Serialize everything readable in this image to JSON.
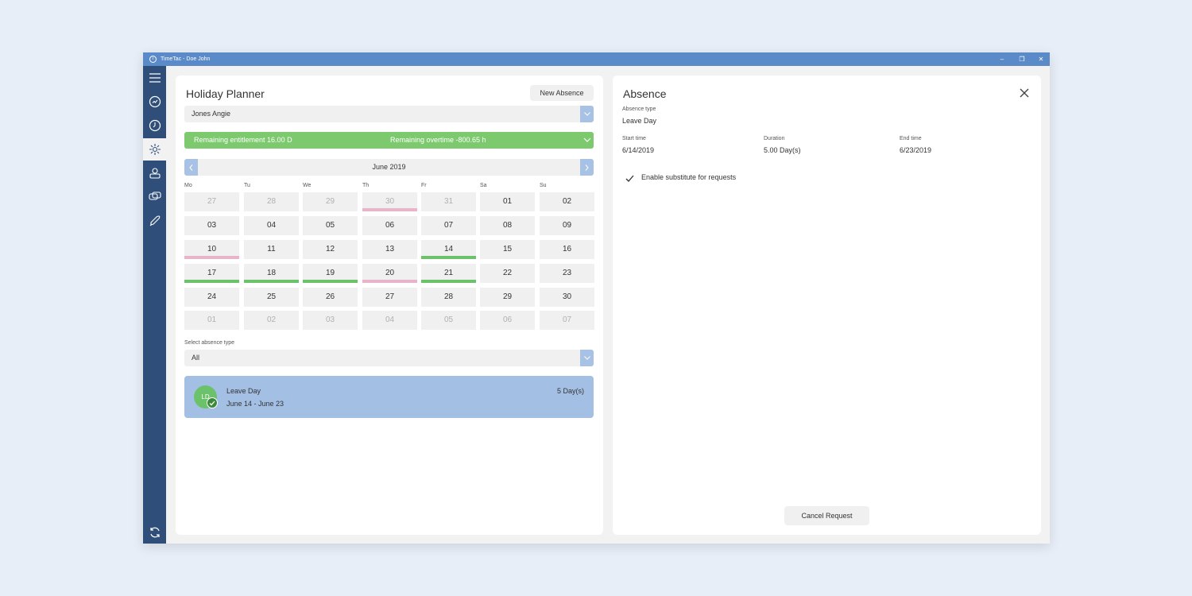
{
  "window": {
    "title": "TimeTac - Doe John",
    "controls": {
      "minimize": "–",
      "restore": "❐",
      "close": "✕"
    }
  },
  "sidebar": {
    "items": [
      {
        "name": "menu-icon"
      },
      {
        "name": "dashboard-icon"
      },
      {
        "name": "clock-icon"
      },
      {
        "name": "holiday-icon",
        "active": true
      },
      {
        "name": "team-icon"
      },
      {
        "name": "chat-icon"
      },
      {
        "name": "rocket-icon"
      }
    ],
    "bottom": {
      "name": "sync-icon"
    }
  },
  "planner": {
    "title": "Holiday Planner",
    "new_absence_label": "New Absence",
    "user_select_value": "Jones Angie",
    "entitlement": "Remaining entitlement 16.00 D",
    "overtime": "Remaining overtime -800.65 h",
    "month_label": "June 2019",
    "weekdays": [
      "Mo",
      "Tu",
      "We",
      "Th",
      "Fr",
      "Sa",
      "Su"
    ],
    "colors": {
      "leave": "#6cc26a",
      "pending": "#e8b4c9",
      "accent": "#a8c2e6"
    },
    "weeks": [
      [
        {
          "d": "27",
          "o": true
        },
        {
          "d": "28",
          "o": true
        },
        {
          "d": "29",
          "o": true
        },
        {
          "d": "30",
          "o": true,
          "m": "pending"
        },
        {
          "d": "31",
          "o": true
        },
        {
          "d": "01"
        },
        {
          "d": "02"
        }
      ],
      [
        {
          "d": "03"
        },
        {
          "d": "04"
        },
        {
          "d": "05"
        },
        {
          "d": "06"
        },
        {
          "d": "07"
        },
        {
          "d": "08"
        },
        {
          "d": "09"
        }
      ],
      [
        {
          "d": "10",
          "m": "pending"
        },
        {
          "d": "11"
        },
        {
          "d": "12"
        },
        {
          "d": "13"
        },
        {
          "d": "14",
          "m": "leave"
        },
        {
          "d": "15"
        },
        {
          "d": "16"
        }
      ],
      [
        {
          "d": "17",
          "m": "leave"
        },
        {
          "d": "18",
          "m": "leave"
        },
        {
          "d": "19",
          "m": "leave"
        },
        {
          "d": "20",
          "m": "pending"
        },
        {
          "d": "21",
          "m": "leave"
        },
        {
          "d": "22"
        },
        {
          "d": "23"
        }
      ],
      [
        {
          "d": "24"
        },
        {
          "d": "25"
        },
        {
          "d": "26"
        },
        {
          "d": "27"
        },
        {
          "d": "28"
        },
        {
          "d": "29"
        },
        {
          "d": "30"
        }
      ],
      [
        {
          "d": "01",
          "o": true
        },
        {
          "d": "02",
          "o": true
        },
        {
          "d": "03",
          "o": true
        },
        {
          "d": "04",
          "o": true
        },
        {
          "d": "05",
          "o": true
        },
        {
          "d": "06",
          "o": true
        },
        {
          "d": "07",
          "o": true
        }
      ]
    ],
    "absence_type_label": "Select absence type",
    "absence_type_value": "All",
    "absence_item": {
      "avatar_initials": "LD",
      "title": "Leave Day",
      "dates": "June 14 - June 23",
      "duration": "5 Day(s)"
    }
  },
  "detail": {
    "title": "Absence",
    "absence_type_label": "Absence type",
    "absence_type_value": "Leave Day",
    "start_label": "Start time",
    "start_value": "6/14/2019",
    "duration_label": "Duration",
    "duration_value": "5.00 Day(s)",
    "end_label": "End time",
    "end_value": "6/23/2019",
    "substitute_label": "Enable substitute for requests",
    "cancel_label": "Cancel Request"
  }
}
